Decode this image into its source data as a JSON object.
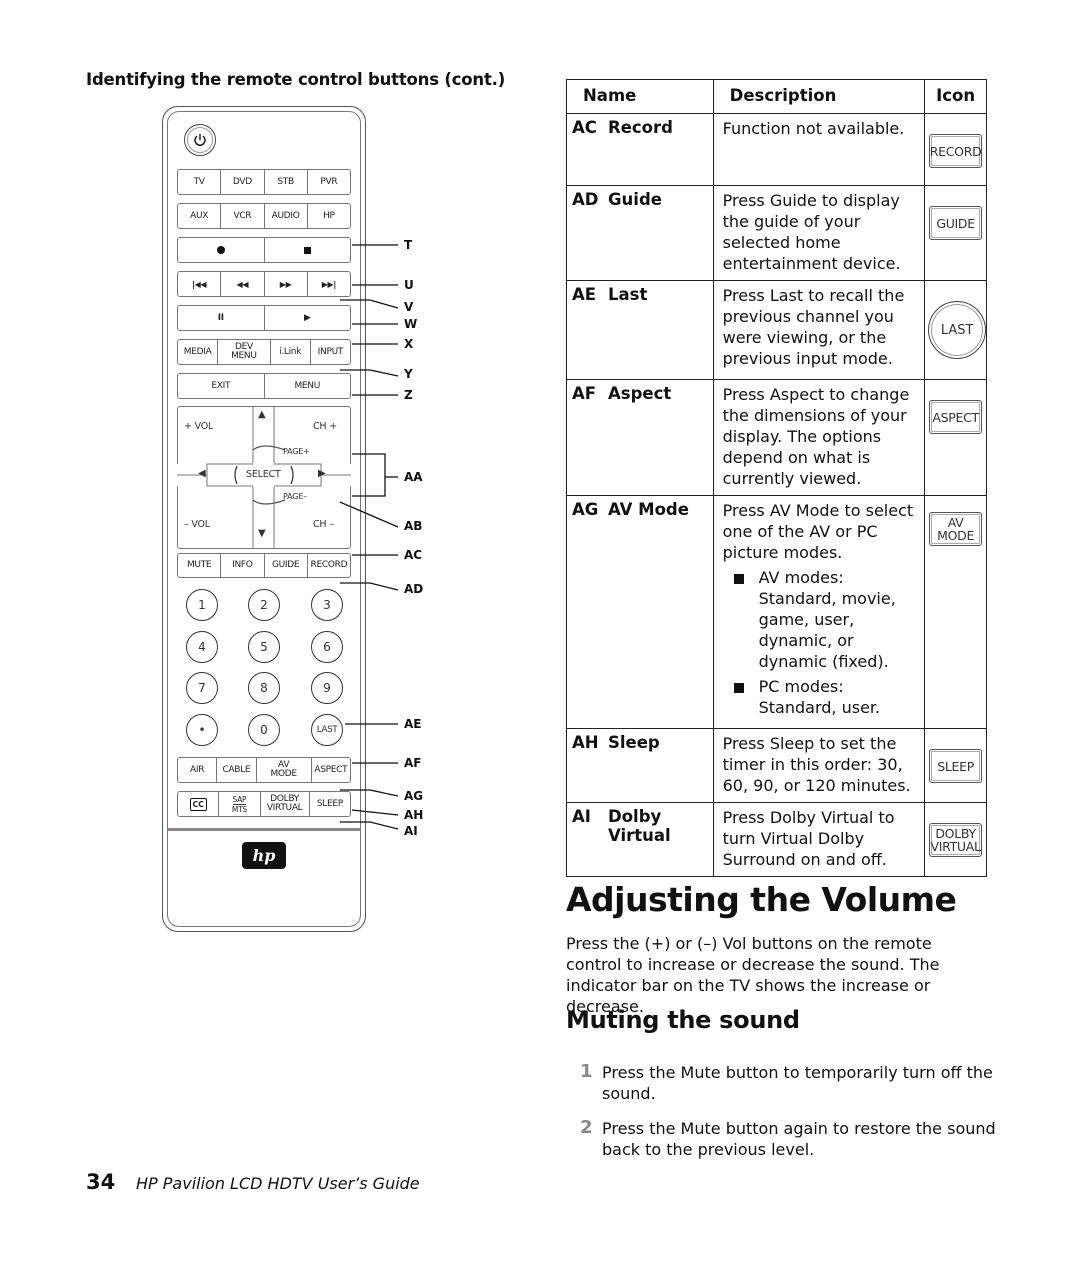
{
  "section_heading": "Identifying the remote control buttons (cont.)",
  "remote": {
    "device_row": [
      "TV",
      "DVD",
      "STB",
      "PVR"
    ],
    "aux_row": [
      "AUX",
      "VCR",
      "AUDIO",
      "HP"
    ],
    "media_row": [
      "MEDIA",
      "DEV MENU",
      "i.Link",
      "INPUT"
    ],
    "exit_row": [
      "EXIT",
      "MENU"
    ],
    "dpad": {
      "vol_up": "+ VOL",
      "ch_up": "CH +",
      "page_up": "PAGE+",
      "select": "SELECT",
      "page_down": "PAGE–",
      "vol_down": "– VOL",
      "ch_down": "CH –"
    },
    "function_row": [
      "MUTE",
      "INFO",
      "GUIDE",
      "RECORD"
    ],
    "number_keys": [
      "1",
      "2",
      "3",
      "4",
      "5",
      "6",
      "7",
      "8",
      "9",
      "•",
      "0",
      "LAST"
    ],
    "mode_row": [
      "AIR",
      "CABLE",
      "AV MODE",
      "ASPECT"
    ],
    "bottom_row": [
      "CC",
      "SAP/MTS",
      "DOLBY VIRTUAL",
      "SLEEP"
    ],
    "logo": "hp"
  },
  "callouts": [
    "T",
    "U",
    "V",
    "W",
    "X",
    "Y",
    "Z",
    "AA",
    "AB",
    "AC",
    "AD",
    "AE",
    "AF",
    "AG",
    "AH",
    "AI"
  ],
  "table": {
    "headers": {
      "name": "Name",
      "description": "Description",
      "icon": "Icon"
    },
    "rows": [
      {
        "code": "AC",
        "name": "Record",
        "description": "Function not available.",
        "icon": "RECORD"
      },
      {
        "code": "AD",
        "name": "Guide",
        "description": "Press Guide to display the guide of your selected home entertainment device.",
        "icon": "GUIDE"
      },
      {
        "code": "AE",
        "name": "Last",
        "description": "Press Last to recall the previous channel you were viewing, or the previous input mode.",
        "icon": "LAST"
      },
      {
        "code": "AF",
        "name": "Aspect",
        "description": "Press Aspect to change the dimensions of your display. The options depend on what is currently viewed.",
        "icon": "ASPECT"
      },
      {
        "code": "AG",
        "name": "AV Mode",
        "description": "Press AV Mode to select one of the AV or PC picture modes.",
        "bullets": [
          "AV modes: Standard, movie, game, user, dynamic, or dynamic (fixed).",
          "PC modes: Standard, user."
        ],
        "icon_line1": "AV",
        "icon_line2": "MODE"
      },
      {
        "code": "AH",
        "name": "Sleep",
        "description": "Press Sleep to set the timer in this order: 30, 60, 90, or 120 minutes.",
        "icon": "SLEEP"
      },
      {
        "code": "AI",
        "name_line1": "Dolby",
        "name_line2": "Virtual",
        "description": "Press Dolby Virtual to turn Virtual Dolby Surround on and off.",
        "icon_line1": "DOLBY",
        "icon_line2": "VIRTUAL"
      }
    ]
  },
  "volume": {
    "title": "Adjusting the Volume",
    "body": "Press the (+) or (–) Vol buttons on the remote control to increase or decrease the sound. The indicator bar on the TV shows the increase or decrease."
  },
  "muting": {
    "title": "Muting the sound",
    "steps": [
      {
        "num": "1",
        "text": "Press the Mute button to temporarily turn off the sound."
      },
      {
        "num": "2",
        "text": "Press the Mute button again to restore the sound back to the previous level."
      }
    ]
  },
  "footer": {
    "page_number": "34",
    "guide_title": "HP Pavilion LCD HDTV User’s Guide"
  }
}
